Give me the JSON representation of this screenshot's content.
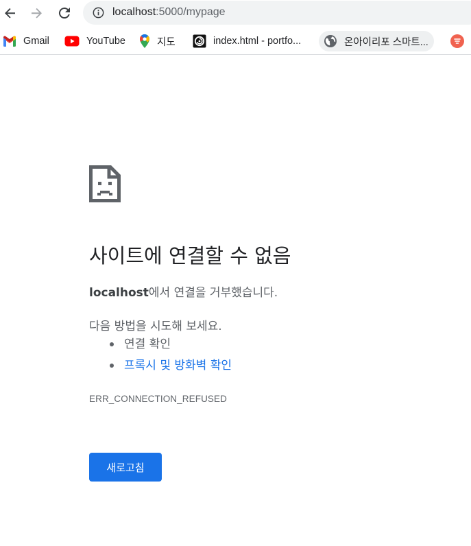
{
  "browser": {
    "url": {
      "host": "localhost",
      "path": ":5000/mypage"
    },
    "icons": {
      "back": "arrow-left-icon",
      "forward": "arrow-right-icon",
      "reload": "reload-icon",
      "site_info": "info-icon"
    }
  },
  "bookmarks": [
    {
      "label": "Gmail",
      "icon": "gmail-icon"
    },
    {
      "label": "YouTube",
      "icon": "youtube-icon"
    },
    {
      "label": "지도",
      "icon": "maps-pin-icon"
    },
    {
      "label": "index.html - portfo...",
      "icon": "portfolio-site-icon"
    },
    {
      "label": "온아이리포 스마트...",
      "icon": "globe-icon"
    },
    {
      "label": "",
      "icon": "red-circle-site-icon"
    }
  ],
  "error": {
    "icon": "sad-page-icon",
    "title": "사이트에 연결할 수 없음",
    "detail_host": "localhost",
    "detail_text": "에서 연결을 거부했습니다.",
    "suggest_intro": "다음 방법을 시도해 보세요.",
    "suggestions": [
      {
        "label": "연결 확인",
        "is_link": false
      },
      {
        "label": "프록시 및 방화벽 확인",
        "is_link": true
      }
    ],
    "code": "ERR_CONNECTION_REFUSED",
    "reload_label": "새로고침"
  },
  "colors": {
    "accent": "#1a73e8",
    "text_primary": "#202124",
    "text_secondary": "#5f6368",
    "omnibox_bg": "#f1f3f4"
  }
}
